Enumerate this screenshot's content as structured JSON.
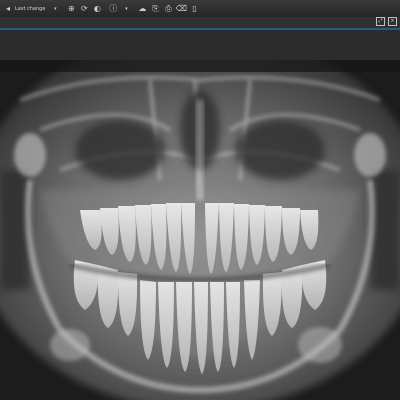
{
  "toolbar": {
    "context_label": "Last change",
    "icons": [
      "back-icon",
      "label",
      "zoom-icon",
      "rotate-icon",
      "brightness-icon",
      "export-icon",
      "print-icon",
      "trash-icon",
      "info-icon"
    ]
  },
  "window_controls": {
    "expand_icon": "expand-icon",
    "close_icon": "close-icon"
  },
  "viewer": {
    "image_type": "panoramic dental x-ray"
  }
}
